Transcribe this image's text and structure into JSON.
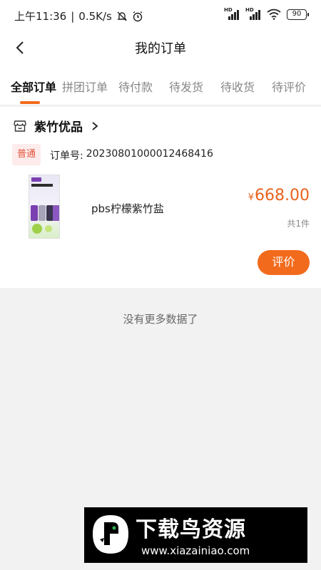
{
  "status_bar": {
    "time": "上午11:36",
    "speed": "0.5K/s",
    "battery": "90"
  },
  "header": {
    "title": "我的订单"
  },
  "tabs": [
    {
      "label": "全部订单",
      "active": true
    },
    {
      "label": "拼团订单",
      "active": false
    },
    {
      "label": "待付款",
      "active": false
    },
    {
      "label": "待发货",
      "active": false
    },
    {
      "label": "待收货",
      "active": false
    },
    {
      "label": "待评价",
      "active": false
    }
  ],
  "order": {
    "shop_name": "紫竹优品",
    "type_badge": "普通",
    "order_no_label": "订单号:",
    "order_no": "20230801000012468416",
    "product_name": "pbs柠檬紫竹盐",
    "currency": "¥",
    "price": "668.00",
    "quantity": "共1件",
    "review_label": "评价"
  },
  "footer_text": "没有更多数据了",
  "watermark": {
    "title": "下载鸟资源",
    "url": "www.xiazainiao.com"
  },
  "colors": {
    "accent": "#f26b1d",
    "price": "#e8621c",
    "badge_text": "#e0523c",
    "badge_bg": "#fdeceb"
  }
}
